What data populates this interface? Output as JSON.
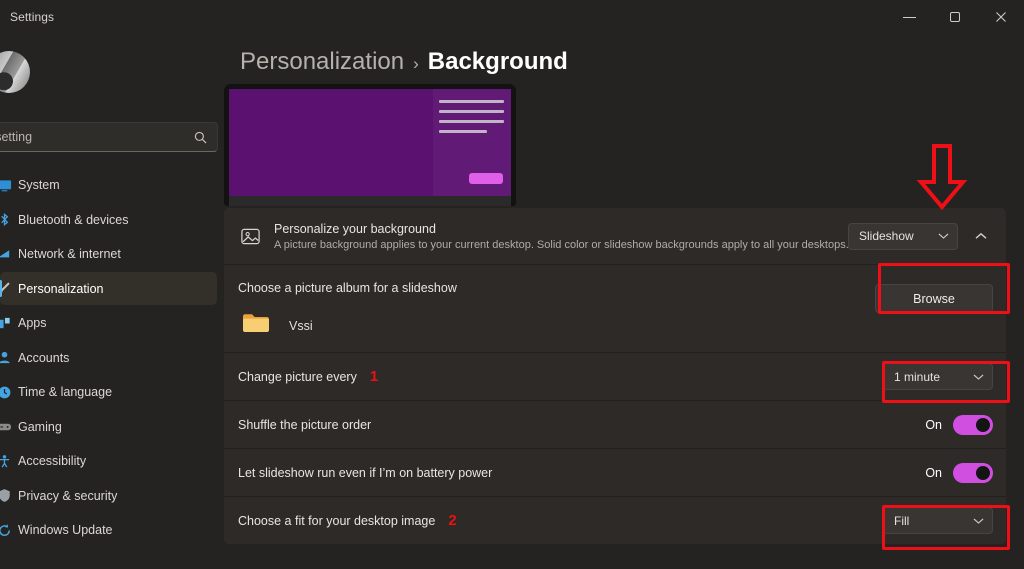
{
  "window": {
    "title": "Settings",
    "controls": [
      {
        "name": "minimize",
        "label": "Minimize"
      },
      {
        "name": "maximize",
        "label": "Restore"
      },
      {
        "name": "close",
        "label": "Close"
      }
    ]
  },
  "sidebar": {
    "account_name": "",
    "search": {
      "placeholder": "Find a setting",
      "value": "",
      "icon": "search-icon"
    },
    "items": [
      {
        "label": "System",
        "icon": "system-icon",
        "active": false
      },
      {
        "label": "Bluetooth & devices",
        "icon": "bluetooth-icon",
        "active": false
      },
      {
        "label": "Network & internet",
        "icon": "network-icon",
        "active": false
      },
      {
        "label": "Personalization",
        "icon": "brush-icon",
        "active": true
      },
      {
        "label": "Apps",
        "icon": "apps-icon",
        "active": false
      },
      {
        "label": "Accounts",
        "icon": "accounts-icon",
        "active": false
      },
      {
        "label": "Time & language",
        "icon": "clock-icon",
        "active": false
      },
      {
        "label": "Gaming",
        "icon": "gaming-icon",
        "active": false
      },
      {
        "label": "Accessibility",
        "icon": "accessibility-icon",
        "active": false
      },
      {
        "label": "Privacy & security",
        "icon": "shield-icon",
        "active": false
      },
      {
        "label": "Windows Update",
        "icon": "update-icon",
        "active": false
      }
    ]
  },
  "header": {
    "breadcrumb_parent": "Personalization",
    "breadcrumb_separator": "›",
    "breadcrumb_current": "Background"
  },
  "preview": {
    "screen_color": "#5A1170",
    "accent_button_color": "#E05FE8",
    "line_color": "#C0B4C6"
  },
  "settings": {
    "personalize": {
      "icon": "picture-icon",
      "title": "Personalize your background",
      "description": "A picture background applies to your current desktop. Solid color or slideshow backgrounds apply to all your desktops.",
      "dropdown_value": "Slideshow",
      "collapse_icon": "chevron-up-icon"
    },
    "album": {
      "label": "Choose a picture album for a slideshow",
      "browse_label": "Browse",
      "folder_icon": "folder-icon",
      "folder_name": "Vssi"
    },
    "change_every": {
      "label": "Change picture every",
      "marker": "1",
      "dropdown_value": "1 minute"
    },
    "shuffle": {
      "label": "Shuffle the picture order",
      "state": "On",
      "toggle_on": true
    },
    "battery": {
      "label": "Let slideshow run even if I’m on battery power",
      "state": "On",
      "toggle_on": true
    },
    "fit": {
      "label": "Choose a fit for your desktop image",
      "marker": "2",
      "dropdown_value": "Fill"
    }
  },
  "annotations": {
    "highlight_color": "#EF0F16",
    "arrow_target": "Slideshow dropdown",
    "boxes": [
      "browse-button",
      "change-every-dropdown",
      "fit-dropdown"
    ]
  }
}
